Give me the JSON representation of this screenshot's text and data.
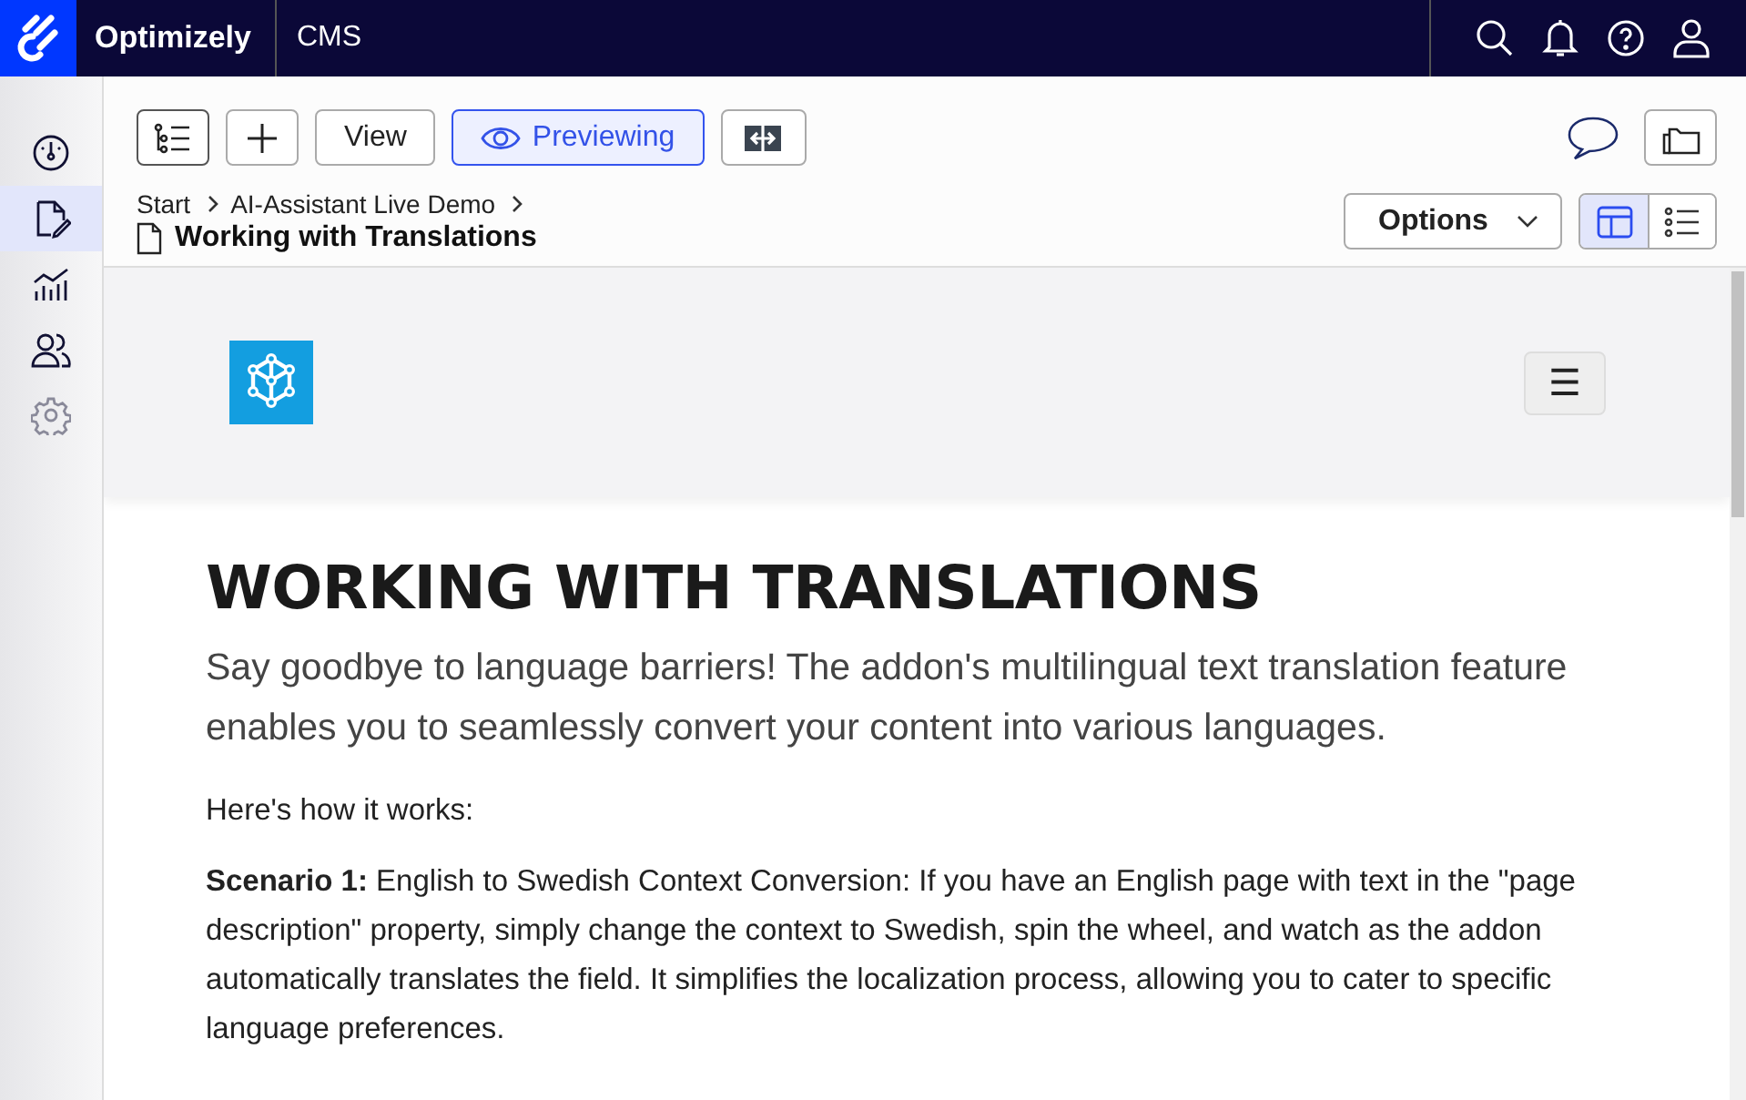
{
  "topbar": {
    "brand": "Optimizely",
    "product": "CMS"
  },
  "sidebar": {
    "items": [
      {
        "kind": "dashboard",
        "selected": false,
        "disabled": false
      },
      {
        "kind": "edit",
        "selected": true,
        "disabled": false
      },
      {
        "kind": "reports",
        "selected": false,
        "disabled": false
      },
      {
        "kind": "visitors",
        "selected": false,
        "disabled": false
      },
      {
        "kind": "settings",
        "selected": false,
        "disabled": true
      }
    ]
  },
  "toolbar": {
    "view_button": "View",
    "preview_button": {
      "label": "Previewing",
      "selected": true
    },
    "options_button": "Options",
    "view_modes": [
      {
        "kind": "layout",
        "selected": true
      },
      {
        "kind": "list",
        "selected": false
      }
    ]
  },
  "breadcrumb": [
    "Start",
    "AI-Assistant Live Demo"
  ],
  "page_title": "Working with Translations",
  "preview": {
    "menu_button": "☰",
    "heading": "WORKING WITH TRANSLATIONS",
    "lead": "Say goodbye to language barriers! The addon's multilingual text translation feature enables you to seamlessly convert your content into various languages.",
    "paragraphs": [
      " Here's how it works:",
      "**Scenario 1:** English to Swedish Context Conversion: If you have an English page with text in the \"page description\" property, simply change the context to Swedish, spin the wheel, and watch as the addon automatically translates the field. It simplifies the localization process, allowing you to cater to specific language preferences."
    ]
  }
}
